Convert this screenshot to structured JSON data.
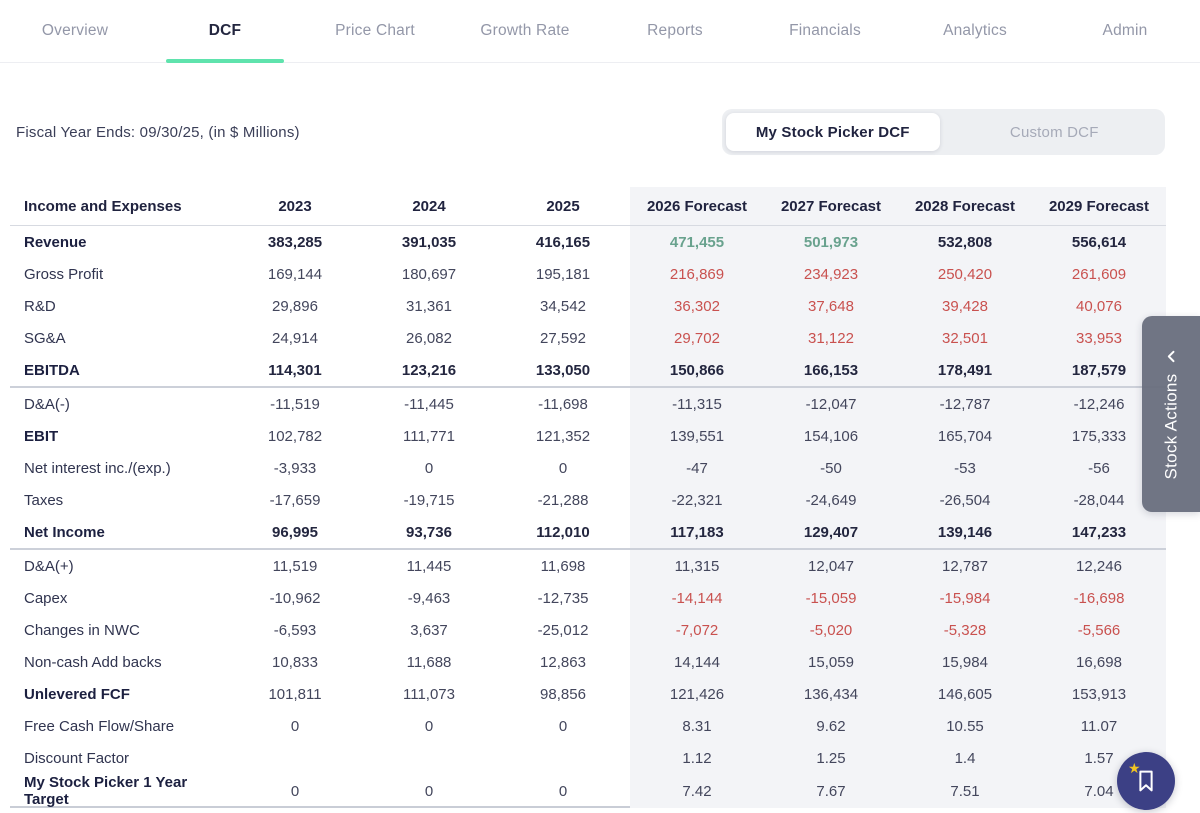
{
  "nav": {
    "tabs": [
      {
        "label": "Overview",
        "active": false
      },
      {
        "label": "DCF",
        "active": true
      },
      {
        "label": "Price Chart",
        "active": false
      },
      {
        "label": "Growth Rate",
        "active": false
      },
      {
        "label": "Reports",
        "active": false
      },
      {
        "label": "Financials",
        "active": false
      },
      {
        "label": "Analytics",
        "active": false
      },
      {
        "label": "Admin",
        "active": false
      }
    ]
  },
  "subheader": {
    "fiscal_note": "Fiscal Year Ends: 09/30/25, (in $ Millions)",
    "toggle": {
      "options": [
        {
          "label": "My Stock Picker DCF",
          "active": true
        },
        {
          "label": "Custom DCF",
          "active": false
        }
      ]
    }
  },
  "table": {
    "columns": [
      "Income and Expenses",
      "2023",
      "2024",
      "2025",
      "2026 Forecast",
      "2027 Forecast",
      "2028 Forecast",
      "2029 Forecast"
    ],
    "rows": [
      {
        "label": "Revenue",
        "bold": true,
        "values_bold": true,
        "values": [
          "383,285",
          "391,035",
          "416,165",
          "471,455",
          "501,973",
          "532,808",
          "556,614"
        ],
        "colors": [
          "",
          "",
          "",
          "green",
          "green",
          "",
          ""
        ]
      },
      {
        "label": "Gross Profit",
        "bold": false,
        "values": [
          "169,144",
          "180,697",
          "195,181",
          "216,869",
          "234,923",
          "250,420",
          "261,609"
        ],
        "colors": [
          "",
          "",
          "",
          "red",
          "red",
          "red",
          "red"
        ]
      },
      {
        "label": "R&D",
        "bold": false,
        "values": [
          "29,896",
          "31,361",
          "34,542",
          "36,302",
          "37,648",
          "39,428",
          "40,076"
        ],
        "colors": [
          "",
          "",
          "",
          "red",
          "red",
          "red",
          "red"
        ]
      },
      {
        "label": "SG&A",
        "bold": false,
        "values": [
          "24,914",
          "26,082",
          "27,592",
          "29,702",
          "31,122",
          "32,501",
          "33,953"
        ],
        "colors": [
          "",
          "",
          "",
          "red",
          "red",
          "red",
          "red"
        ]
      },
      {
        "label": "EBITDA",
        "bold": true,
        "values_bold": true,
        "divider": true,
        "values": [
          "114,301",
          "123,216",
          "133,050",
          "150,866",
          "166,153",
          "178,491",
          "187,579"
        ]
      },
      {
        "label": "D&A(-)",
        "bold": false,
        "values": [
          "-11,519",
          "-11,445",
          "-11,698",
          "-11,315",
          "-12,047",
          "-12,787",
          "-12,246"
        ]
      },
      {
        "label": "EBIT",
        "bold": true,
        "values": [
          "102,782",
          "111,771",
          "121,352",
          "139,551",
          "154,106",
          "165,704",
          "175,333"
        ]
      },
      {
        "label": "Net interest inc./(exp.)",
        "bold": false,
        "values": [
          "-3,933",
          "0",
          "0",
          "-47",
          "-50",
          "-53",
          "-56"
        ]
      },
      {
        "label": "Taxes",
        "bold": false,
        "values": [
          "-17,659",
          "-19,715",
          "-21,288",
          "-22,321",
          "-24,649",
          "-26,504",
          "-28,044"
        ]
      },
      {
        "label": "Net Income",
        "bold": true,
        "values_bold": true,
        "divider": true,
        "values": [
          "96,995",
          "93,736",
          "112,010",
          "117,183",
          "129,407",
          "139,146",
          "147,233"
        ]
      },
      {
        "label": "D&A(+)",
        "bold": false,
        "values": [
          "11,519",
          "11,445",
          "11,698",
          "11,315",
          "12,047",
          "12,787",
          "12,246"
        ]
      },
      {
        "label": "Capex",
        "bold": false,
        "values": [
          "-10,962",
          "-9,463",
          "-12,735",
          "-14,144",
          "-15,059",
          "-15,984",
          "-16,698"
        ],
        "colors": [
          "",
          "",
          "",
          "red",
          "red",
          "red",
          "red"
        ]
      },
      {
        "label": "Changes in NWC",
        "bold": false,
        "values": [
          "-6,593",
          "3,637",
          "-25,012",
          "-7,072",
          "-5,020",
          "-5,328",
          "-5,566"
        ],
        "colors": [
          "",
          "",
          "",
          "red",
          "red",
          "red",
          "red"
        ]
      },
      {
        "label": "Non-cash Add backs",
        "bold": false,
        "values": [
          "10,833",
          "11,688",
          "12,863",
          "14,144",
          "15,059",
          "15,984",
          "16,698"
        ]
      },
      {
        "label": "Unlevered FCF",
        "bold": true,
        "values": [
          "101,811",
          "111,073",
          "98,856",
          "121,426",
          "136,434",
          "146,605",
          "153,913"
        ]
      },
      {
        "label": "Free Cash Flow/Share",
        "bold": false,
        "values": [
          "0",
          "0",
          "0",
          "8.31",
          "9.62",
          "10.55",
          "11.07"
        ]
      },
      {
        "label": "Discount Factor",
        "bold": false,
        "values": [
          "",
          "",
          "",
          "1.12",
          "1.25",
          "1.4",
          "1.57"
        ]
      },
      {
        "label": "My Stock Picker 1 Year Target",
        "bold": true,
        "values": [
          "0",
          "0",
          "0",
          "7.42",
          "7.67",
          "7.51",
          "7.04"
        ]
      }
    ]
  },
  "stock_actions": {
    "label": "Stock Actions",
    "chevron_icon": "chevron-up-icon"
  },
  "fab": {
    "icon": "bookmark-icon",
    "accent_icon": "star-icon"
  },
  "colors": {
    "green": "#69a28e",
    "red": "#c9514f",
    "mint_accent": "#5fe3ad",
    "navy": "#23263f",
    "forecast_bg": "#f3f4f7",
    "side_tab_bg": "#686f7d",
    "fab_bg": "#3c4085",
    "star_yellow": "#f2c522"
  }
}
